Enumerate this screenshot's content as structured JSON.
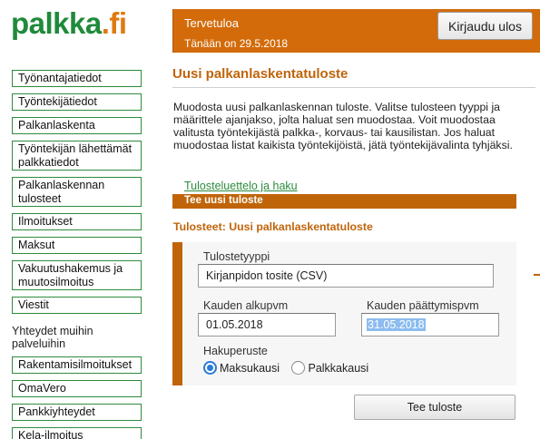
{
  "brand": {
    "name_part1": "palkka",
    "name_part2": ".fi"
  },
  "header": {
    "welcome": "Tervetuloa",
    "date_text": "Tänään on 29.5.2018",
    "logout_label": "Kirjaudu ulos"
  },
  "sidebar": {
    "items": [
      {
        "label": "Työnantajatiedot"
      },
      {
        "label": "Työntekijätiedot"
      },
      {
        "label": "Palkanlaskenta"
      },
      {
        "label": "Työntekijän lähettämät palkkatiedot"
      },
      {
        "label": "Palkanlaskennan tulosteet"
      },
      {
        "label": "Ilmoitukset"
      },
      {
        "label": "Maksut"
      },
      {
        "label": "Vakuutushakemus ja muutosilmoitus"
      },
      {
        "label": "Viestit"
      }
    ],
    "other_services_heading": "Yhteydet muihin palveluihin",
    "other_services": [
      {
        "label": "Rakentamisilmoitukset"
      },
      {
        "label": "OmaVero"
      },
      {
        "label": "Pankkiyhteydet"
      },
      {
        "label": "Kela-ilmoitus"
      }
    ]
  },
  "main": {
    "title": "Uusi palkanlaskentatuloste",
    "intro": "Muodosta uusi palkanlaskennan tuloste. Valitse tulosteen tyyppi ja määrittele ajanjakso, jolta haluat sen muodostaa. Voit muodostaa valitusta työntekijästä palkka-, korvaus- tai kausilistan. Jos haluat muodostaa listat kaikista työntekijöistä, jätä työntekijävalinta tyhjäksi.",
    "tabs": {
      "list_link": "Tulosteluettelo ja haku",
      "active": "Tee uusi tuloste"
    },
    "section_title": "Tulosteet: Uusi palkanlaskentatuloste",
    "form": {
      "type_label": "Tulostetyyppi",
      "type_value": "Kirjanpidon tosite (CSV)",
      "start_label": "Kauden alkupvm",
      "start_value": "01.05.2018",
      "end_label": "Kauden päättymispvm",
      "end_value": "31.05.2018",
      "basis_label": "Hakuperuste",
      "basis_options": [
        {
          "label": "Maksukausi",
          "selected": true
        },
        {
          "label": "Palkkakausi",
          "selected": false
        }
      ],
      "submit_label": "Tee tuloste"
    }
  },
  "colors": {
    "brand_green": "#1f8a3a",
    "brand_orange": "#e07a10",
    "accent_orange": "#c0640a",
    "header_orange": "#d36b0a",
    "nav_border_green": "#2e8b3e"
  }
}
